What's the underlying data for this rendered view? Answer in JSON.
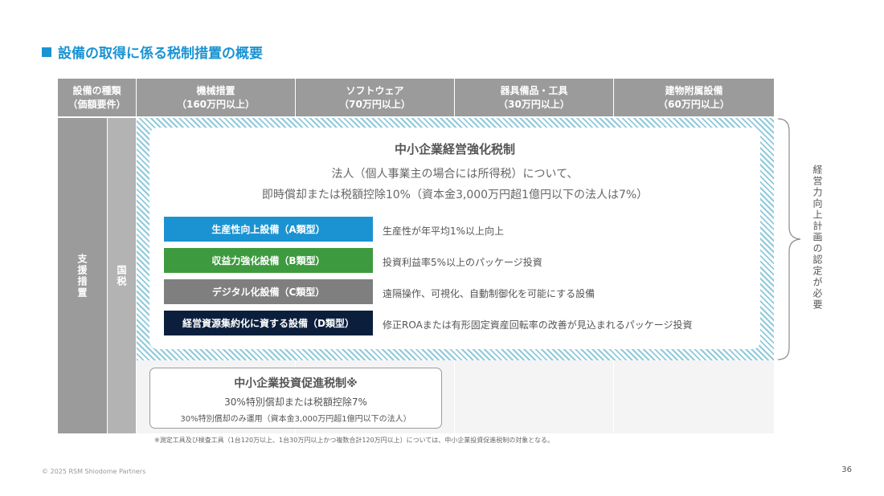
{
  "title": "設備の取得に係る税制措置の概要",
  "header": {
    "type_label": [
      "設備の種類",
      "（価額要件）"
    ],
    "columns": [
      {
        "name": "機械措置",
        "req": "（160万円以上）"
      },
      {
        "name": "ソフトウェア",
        "req": "（70万円以上）"
      },
      {
        "name": "器具備品・工具",
        "req": "（30万円以上）"
      },
      {
        "name": "建物附属設備",
        "req": "（60万円以上）"
      }
    ]
  },
  "row_labels": {
    "support": "支援措置",
    "national_tax": "国税"
  },
  "enhancement": {
    "heading": "中小企業経営強化税制",
    "line1": "法人（個人事業主の場合には所得税）について、",
    "line2": "即時償却または税額控除10%（資本金3,000万円超1億円以下の法人は7%）",
    "categories": [
      {
        "label": "生産性向上設備（A類型）",
        "desc": "生産性が年平均1%以上向上",
        "color": "#1b93d2"
      },
      {
        "label": "収益力強化設備（B類型）",
        "desc": "投資利益率5%以上のパッケージ投資",
        "color": "#3e9a3e"
      },
      {
        "label": "デジタル化設備（C類型）",
        "desc": "遠隔操作、可視化、自動制御化を可能にする設備",
        "color": "#7f7f7f"
      },
      {
        "label": "経営資源集約化に資する設備（D類型）",
        "desc": "修正ROAまたは有形固定資産回転率の改善が見込まれるパッケージ投資",
        "color": "#0b1f3d"
      }
    ]
  },
  "investment": {
    "heading": "中小企業投資促進税制※",
    "line1": "30%特別償却または税額控除7%",
    "line2": "30%特別償却のみ運用（資本金3,000万円超1億円以下の法人）"
  },
  "bracket_label": "経営力向上計画の認定が必要",
  "footnote": "※測定工具及び検査工具（1台120万以上、1台30万円以上かつ複数合計120万円以上）については、中小企業投資促進税制の対象となる。",
  "copyright": "© 2025 RSM Shiodome Partners",
  "page_number": "36"
}
